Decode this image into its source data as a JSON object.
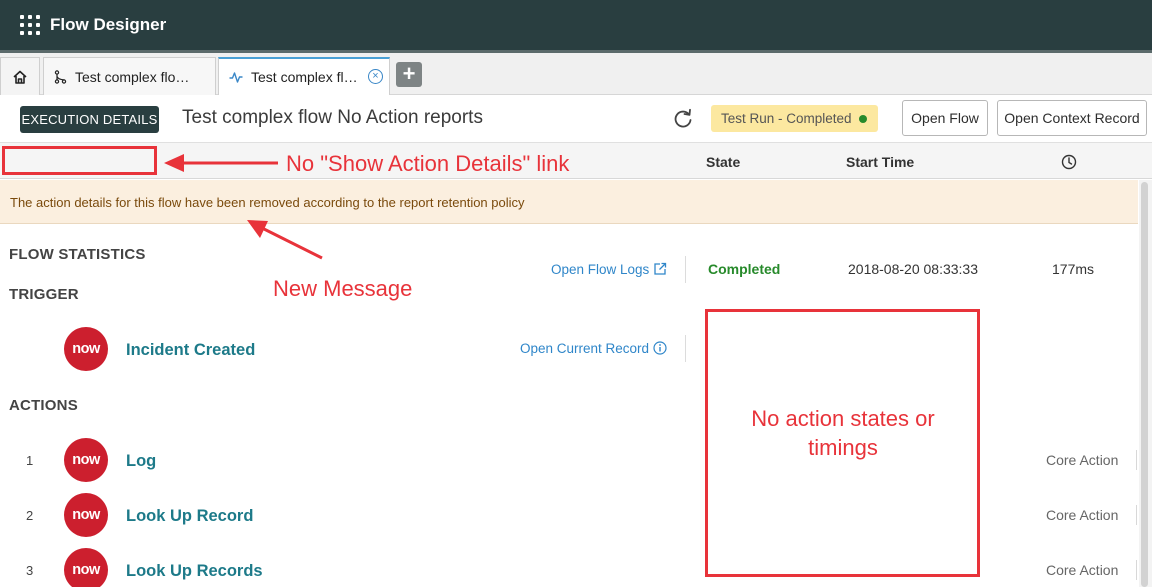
{
  "app": {
    "title": "Flow Designer"
  },
  "tabs": [
    {
      "label": "Test complex flo…"
    },
    {
      "label": "Test complex flo…"
    }
  ],
  "header": {
    "badge": "EXECUTION DETAILS",
    "title": "Test complex flow No Action reports",
    "status": "Test Run - Completed",
    "open_flow": "Open Flow",
    "open_context": "Open Context Record"
  },
  "columns": {
    "state": "State",
    "start_time": "Start Time"
  },
  "message": "The action details for this flow have been removed according to the report retention policy",
  "flow_statistics": {
    "heading": "FLOW STATISTICS",
    "open_logs": "Open Flow Logs",
    "state": "Completed",
    "start_time": "2018-08-20 08:33:33",
    "duration": "177ms"
  },
  "trigger": {
    "heading": "TRIGGER",
    "logo": "now",
    "name": "Incident Created",
    "open_record": "Open Current Record"
  },
  "actions": {
    "heading": "ACTIONS",
    "items": [
      {
        "num": "1",
        "logo": "now",
        "name": "Log",
        "type": "Core Action"
      },
      {
        "num": "2",
        "logo": "now",
        "name": "Look Up Record",
        "type": "Core Action"
      },
      {
        "num": "3",
        "logo": "now",
        "name": "Look Up Records",
        "type": "Core Action"
      }
    ]
  },
  "annotations": {
    "no_link": "No \"Show Action Details\" link",
    "new_message": "New Message",
    "no_states_line1": "No action states or",
    "no_states_line2": "timings"
  },
  "colors": {
    "accent": "#293e40",
    "annotation": "#e8333a",
    "success": "#278a2b",
    "link": "#2f86c9",
    "logo": "#cc1f2e"
  },
  "icons": [
    "grid-menu-icon",
    "home-icon",
    "flow-icon",
    "activity-icon",
    "close-icon",
    "plus-icon",
    "refresh-icon",
    "clock-icon",
    "external-link-icon",
    "info-icon"
  ]
}
